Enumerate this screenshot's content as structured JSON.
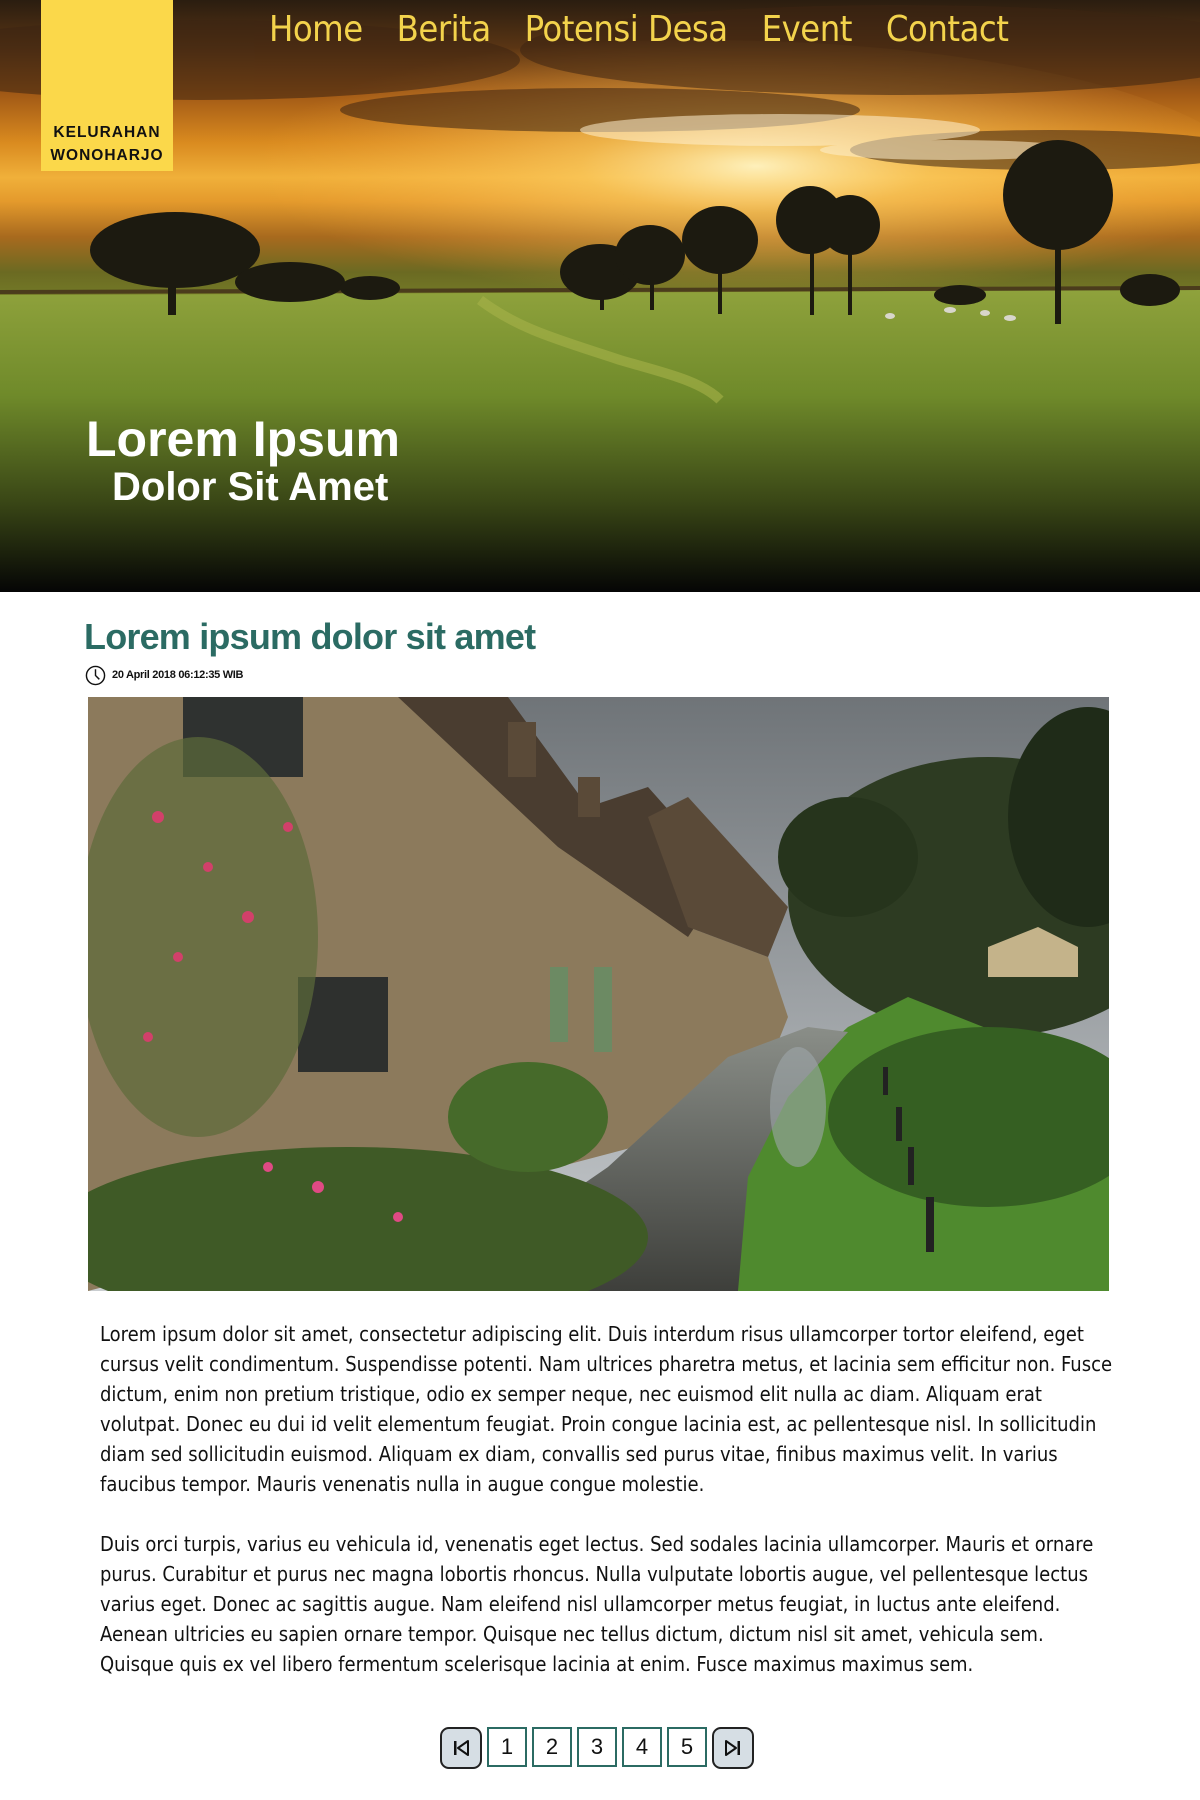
{
  "logo": {
    "line1": "KELURAHAN",
    "line2": "WONOHARJO"
  },
  "nav": {
    "items": [
      {
        "label": "Home"
      },
      {
        "label": "Berita"
      },
      {
        "label": "Potensi Desa"
      },
      {
        "label": "Event"
      },
      {
        "label": "Contact"
      }
    ]
  },
  "hero": {
    "title": "Lorem Ipsum",
    "subtitle": "Dolor Sit Amet"
  },
  "article": {
    "title": "Lorem ipsum dolor sit amet",
    "timestamp": "20 April 2018 06:12:35 WIB",
    "paragraphs": [
      "Lorem ipsum dolor sit amet, consectetur adipiscing elit. Duis interdum risus ullamcorper tortor eleifend, eget cursus velit condimentum. Suspendisse potenti. Nam ultrices pharetra metus, et lacinia sem efficitur non. Fusce dictum, enim non pretium tristique, odio ex semper neque, nec euismod elit nulla ac diam.  Aliquam erat volutpat. Donec eu dui id velit elementum feugiat. Proin congue lacinia est, ac pellentesque nisl. In sollicitudin diam sed sollicitudin euismod. Aliquam ex diam, convallis sed purus vitae, finibus maximus velit. In varius faucibus tempor. Mauris venenatis nulla in augue congue molestie.",
      "Duis orci turpis, varius eu vehicula id, venenatis eget lectus. Sed sodales lacinia ullamcorper. Mauris et ornare purus. Curabitur et purus nec magna lobortis rhoncus. Nulla vulputate lobortis augue, vel pellentesque lectus varius eget. Donec ac sagittis augue. Nam eleifend nisl ullamcorper metus feugiat, in luctus ante eleifend. Aenean ultricies eu sapien ornare tempor. Quisque nec tellus dictum, dictum nisl sit amet, vehicula sem. Quisque quis ex vel libero fermentum scelerisque lacinia at enim. Fusce maximus maximus sem."
    ]
  },
  "pagination": {
    "first_icon": "skip-to-first-icon",
    "last_icon": "skip-to-last-icon",
    "pages": [
      "1",
      "2",
      "3",
      "4",
      "5"
    ]
  },
  "colors": {
    "logo_bg": "#fbd84a",
    "nav_text": "#f3d34c",
    "article_title": "#2b6b63",
    "pagination_border": "#2b6b63"
  }
}
